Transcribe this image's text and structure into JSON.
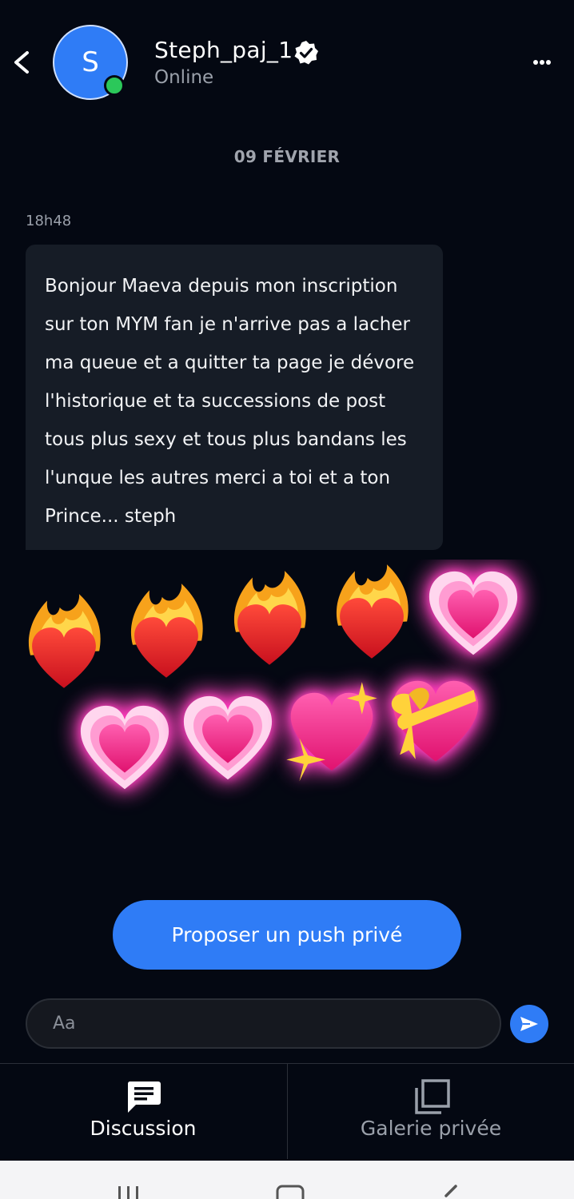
{
  "header": {
    "avatar_letter": "S",
    "username": "Steph_paj_1",
    "status": "Online"
  },
  "conversation": {
    "date_separator": "09 FÉVRIER",
    "message": {
      "time": "18h48",
      "text": "Bonjour Maeva depuis mon inscription sur ton MYM fan je n'arrive pas a lacher ma queue et a quitter ta page je dévore l'historique et ta successions de post tous plus sexy et tous plus bandans les l'unque les autres merci a toi et a ton Prince... steph"
    },
    "reaction_emojis": [
      "heart-on-fire",
      "heart-on-fire",
      "heart-on-fire",
      "heart-on-fire",
      "growing-heart",
      "growing-heart",
      "growing-heart",
      "sparkling-heart",
      "heart-with-ribbon"
    ]
  },
  "actions": {
    "push_button": "Proposer un push privé"
  },
  "composer": {
    "placeholder": "Aa"
  },
  "tabs": {
    "discussion": "Discussion",
    "gallery": "Galerie privée"
  },
  "colors": {
    "accent": "#2f7cf6",
    "background": "#040812",
    "bubble": "#161c26",
    "online": "#2bc85a"
  }
}
